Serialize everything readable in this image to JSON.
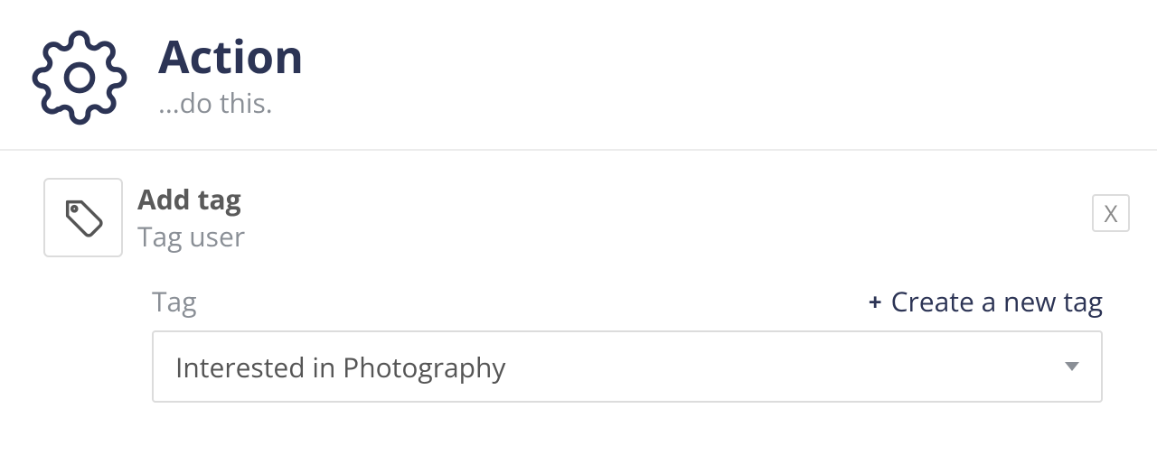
{
  "header": {
    "title": "Action",
    "subtitle": "...do this."
  },
  "action": {
    "title": "Add tag",
    "subtitle": "Tag user",
    "close_label": "X"
  },
  "field": {
    "label": "Tag",
    "create_link": "Create a new tag",
    "selected": "Interested in Photography"
  }
}
